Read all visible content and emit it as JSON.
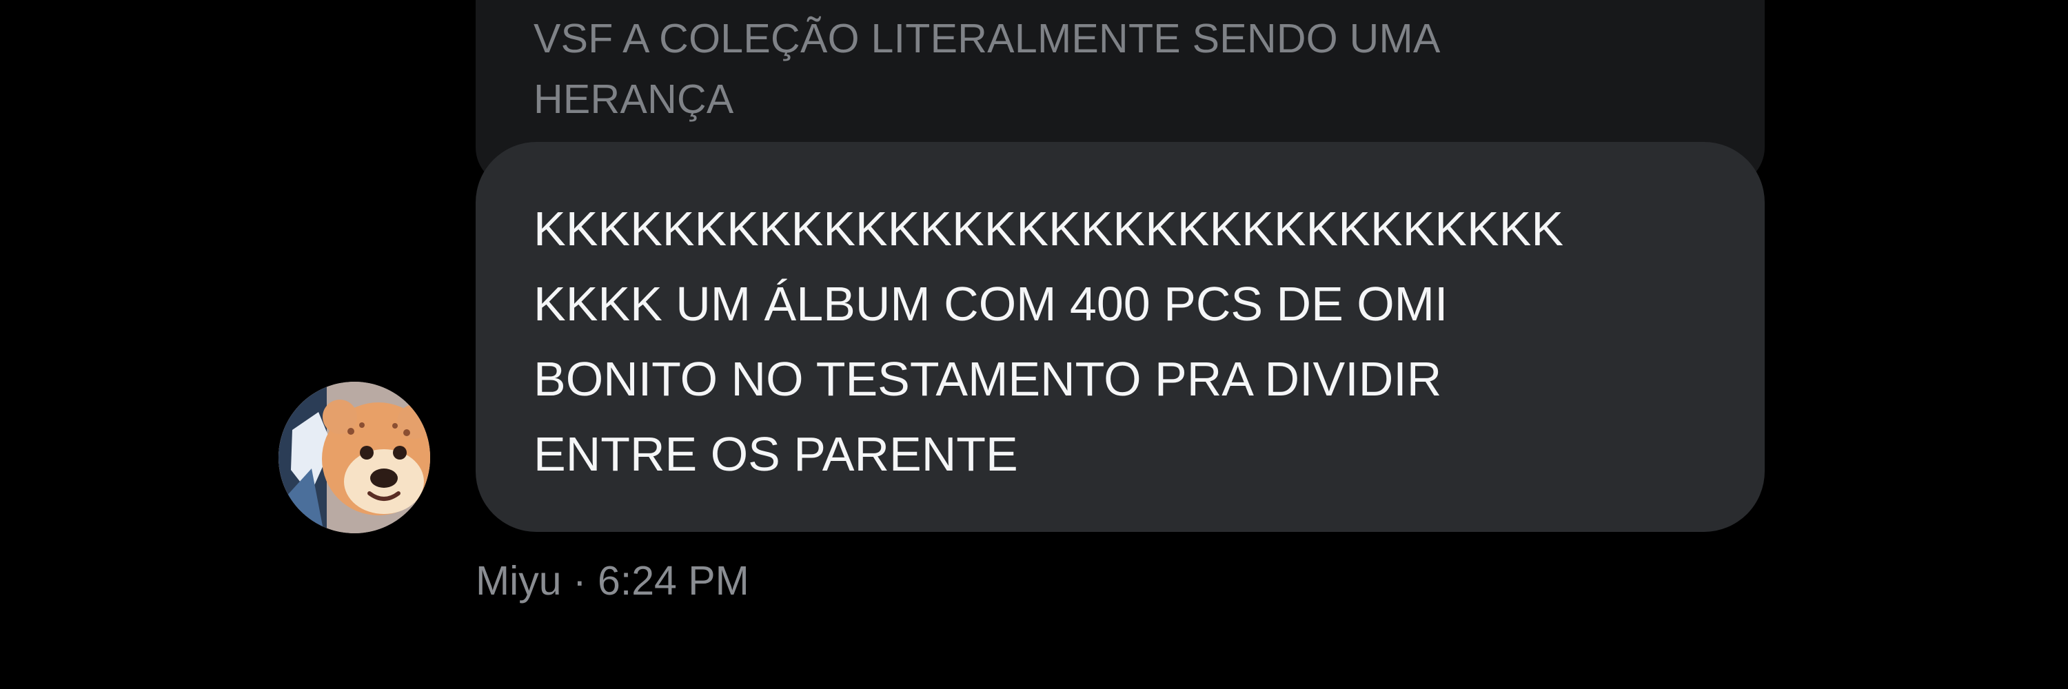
{
  "quoted_message": {
    "text": "VSF A COLEÇÃO LITERALMENTE SENDO UMA\nHERANÇA"
  },
  "message": {
    "text": "KKKKKKKKKKKKKKKKKKKKKKKKKKKKKKKK\nKKKK UM ÁLBUM COM 400 PCS DE OMI\nBONITO NO TESTAMENTO PRA DIVIDIR\nENTRE OS PARENTE"
  },
  "sender": {
    "name": "Miyu",
    "separator": "·",
    "time": "6:24 PM",
    "meta_text": "Miyu · 6:24 PM",
    "avatar_icon": "sticker-avatar-icon"
  },
  "colors": {
    "background": "#000000",
    "quoted_bubble": "#17181a",
    "message_bubble": "#2a2c2f",
    "message_text": "#f5f6f7",
    "muted_text": "#8a8d92"
  }
}
